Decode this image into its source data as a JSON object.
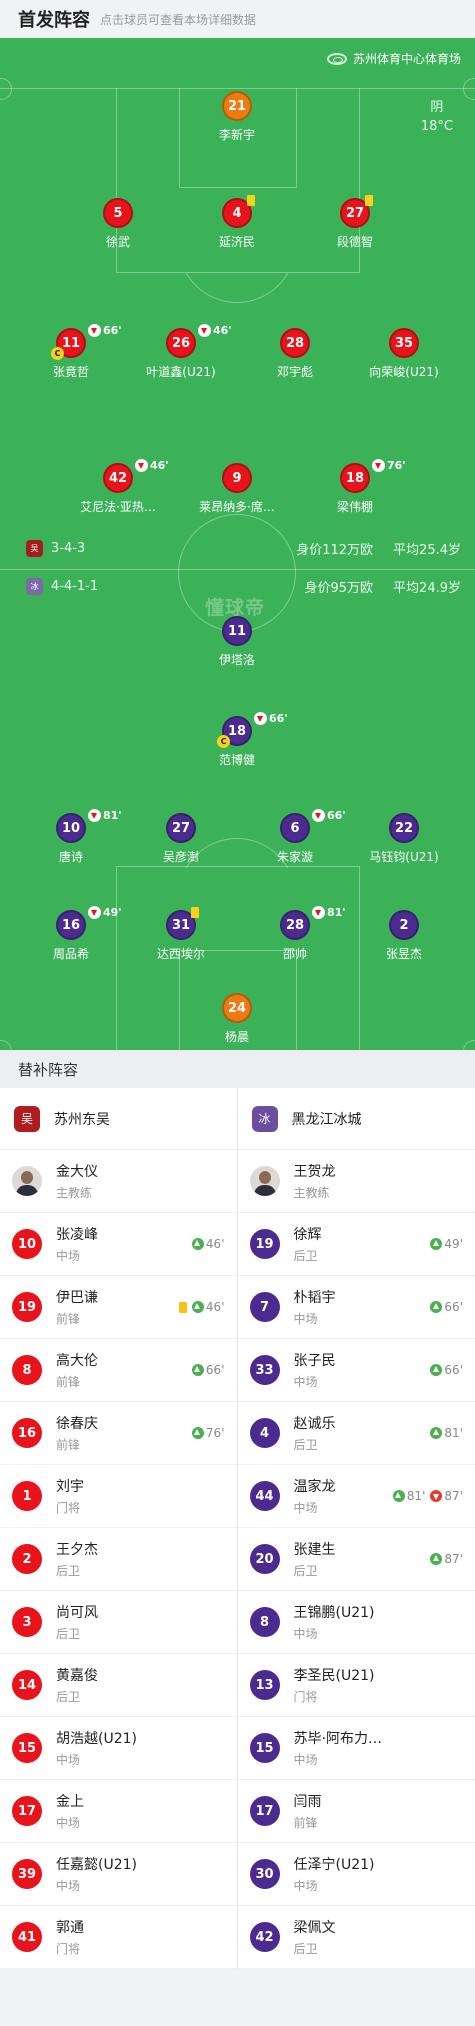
{
  "header": {
    "title": "首发阵容",
    "hint": "点击球员可查看本场详细数据"
  },
  "venue": "苏州体育中心体育场",
  "weather": {
    "condition": "阴",
    "temp": "18°C"
  },
  "watermark": "懂球帝",
  "home": {
    "name": "苏州东吴",
    "formation": "3-4-3",
    "value": "身价112万欧",
    "avg_age": "平均25.4岁",
    "lineup": [
      {
        "num": "21",
        "name": "李新宇",
        "role": "gk"
      },
      {
        "num": "5",
        "name": "徐武"
      },
      {
        "num": "4",
        "name": "延济民",
        "yellow": true
      },
      {
        "num": "27",
        "name": "段德智",
        "yellow": true
      },
      {
        "num": "11",
        "name": "张竟哲",
        "sub": "66'",
        "captain": true
      },
      {
        "num": "26",
        "name": "叶道鑫(U21)",
        "sub": "46'"
      },
      {
        "num": "28",
        "name": "邓宇彪"
      },
      {
        "num": "35",
        "name": "向荣峻(U21)"
      },
      {
        "num": "42",
        "name": "艾尼法·亚热…",
        "sub": "46'"
      },
      {
        "num": "9",
        "name": "莱昂纳多·席…"
      },
      {
        "num": "18",
        "name": "梁伟棚",
        "sub": "76'"
      }
    ]
  },
  "away": {
    "name": "黑龙江冰城",
    "formation": "4-4-1-1",
    "value": "身价95万欧",
    "avg_age": "平均24.9岁",
    "lineup": [
      {
        "num": "11",
        "name": "伊塔洛"
      },
      {
        "num": "18",
        "name": "范博健",
        "sub": "66'",
        "captain": true
      },
      {
        "num": "10",
        "name": "唐诗",
        "sub": "81'"
      },
      {
        "num": "27",
        "name": "吴彦澍"
      },
      {
        "num": "6",
        "name": "朱家漩",
        "sub": "66'"
      },
      {
        "num": "22",
        "name": "马钰钧(U21)"
      },
      {
        "num": "16",
        "name": "周品希",
        "sub": "49'"
      },
      {
        "num": "31",
        "name": "达西埃尔",
        "yellow": true
      },
      {
        "num": "28",
        "name": "邵帅",
        "sub": "81'"
      },
      {
        "num": "2",
        "name": "张昱杰"
      },
      {
        "num": "24",
        "name": "杨晨",
        "role": "gk"
      }
    ]
  },
  "subs_title": "替补阵容",
  "subs": {
    "home": {
      "team": "苏州东吴",
      "coach": {
        "name": "金大仪",
        "role": "主教练"
      },
      "players": [
        {
          "num": "10",
          "name": "张凌峰",
          "pos": "中场",
          "in": "46'"
        },
        {
          "num": "19",
          "name": "伊巴谦",
          "pos": "前锋",
          "yellow": true,
          "in": "46'"
        },
        {
          "num": "8",
          "name": "高大伦",
          "pos": "前锋",
          "in": "66'"
        },
        {
          "num": "16",
          "name": "徐春庆",
          "pos": "前锋",
          "in": "76'"
        },
        {
          "num": "1",
          "name": "刘宇",
          "pos": "门将"
        },
        {
          "num": "2",
          "name": "王夕杰",
          "pos": "后卫"
        },
        {
          "num": "3",
          "name": "尚可风",
          "pos": "后卫"
        },
        {
          "num": "14",
          "name": "黄嘉俊",
          "pos": "后卫"
        },
        {
          "num": "15",
          "name": "胡浩越(U21)",
          "pos": "中场"
        },
        {
          "num": "17",
          "name": "金上",
          "pos": "中场"
        },
        {
          "num": "39",
          "name": "任嘉懿(U21)",
          "pos": "中场"
        },
        {
          "num": "41",
          "name": "郭通",
          "pos": "门将"
        }
      ]
    },
    "away": {
      "team": "黑龙江冰城",
      "coach": {
        "name": "王贺龙",
        "role": "主教练"
      },
      "players": [
        {
          "num": "19",
          "name": "徐辉",
          "pos": "后卫",
          "in": "49'"
        },
        {
          "num": "7",
          "name": "朴韬宇",
          "pos": "中场",
          "in": "66'"
        },
        {
          "num": "33",
          "name": "张子民",
          "pos": "中场",
          "in": "66'"
        },
        {
          "num": "4",
          "name": "赵诚乐",
          "pos": "后卫",
          "in": "81'"
        },
        {
          "num": "44",
          "name": "温家龙",
          "pos": "中场",
          "in": "81'",
          "out": "87'"
        },
        {
          "num": "20",
          "name": "张建生",
          "pos": "后卫",
          "in": "87'"
        },
        {
          "num": "8",
          "name": "王锦鹏(U21)",
          "pos": "中场"
        },
        {
          "num": "13",
          "name": "李圣民(U21)",
          "pos": "门将"
        },
        {
          "num": "15",
          "name": "苏毕·阿布力…",
          "pos": "中场"
        },
        {
          "num": "17",
          "name": "闫雨",
          "pos": "前锋"
        },
        {
          "num": "30",
          "name": "任泽宁(U21)",
          "pos": "中场"
        },
        {
          "num": "42",
          "name": "梁佩文",
          "pos": "后卫"
        }
      ]
    }
  },
  "colors": {
    "home": "#e8131b",
    "away": "#4b2b90",
    "gk": "#f07a10",
    "pitch": "#3bb158"
  }
}
